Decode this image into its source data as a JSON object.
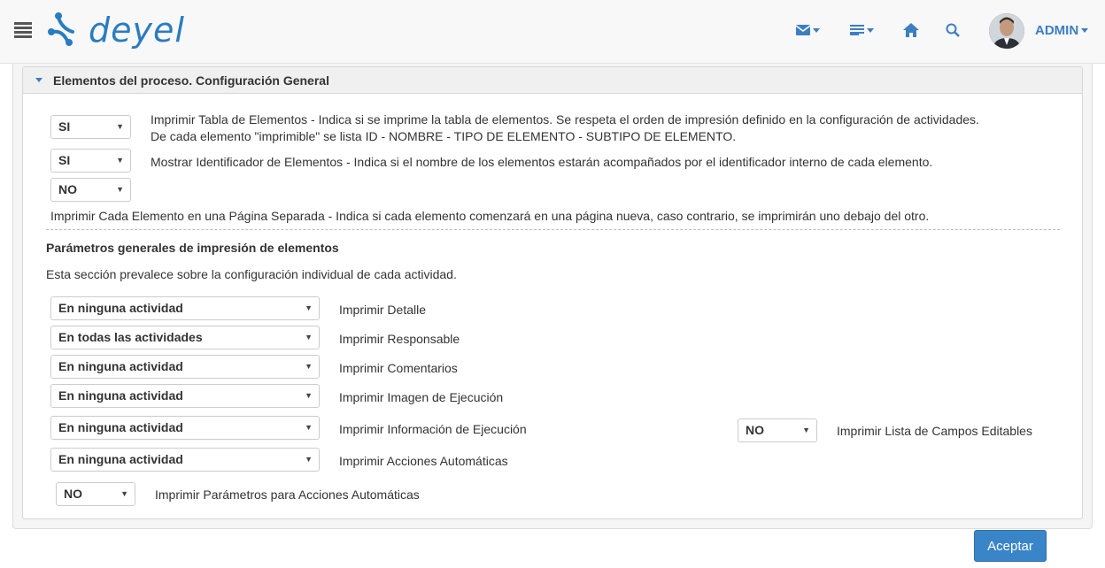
{
  "header": {
    "logo_text": "deyel",
    "user_label": "ADMIN"
  },
  "panel": {
    "title": "Elementos del proceso. Configuración General"
  },
  "top_options": [
    {
      "value": "SI",
      "label_line1": "Imprimir Tabla de Elementos - Indica si se imprime la tabla de elementos. Se respeta el orden de impresión definido en la configuración de actividades.",
      "label_line2": "De cada elemento \"imprimible\" se lista ID - NOMBRE - TIPO DE ELEMENTO - SUBTIPO DE ELEMENTO."
    },
    {
      "value": "SI",
      "label": "Mostrar Identificador de Elementos - Indica si el nombre de los elementos estarán acompañados por el identificador interno de cada elemento."
    },
    {
      "value": "NO",
      "label": "Imprimir Cada Elemento en una Página Separada - Indica si cada elemento comenzará en una página nueva, caso contrario, se imprimirán uno debajo del otro."
    }
  ],
  "section": {
    "title": "Parámetros generales de impresión de elementos",
    "description": "Esta sección prevalece sobre la configuración individual de cada actividad."
  },
  "print_params": [
    {
      "value": "En ninguna actividad",
      "label": "Imprimir Detalle"
    },
    {
      "value": "En todas las actividades",
      "label": "Imprimir Responsable"
    },
    {
      "value": "En ninguna actividad",
      "label": "Imprimir Comentarios"
    },
    {
      "value": "En ninguna actividad",
      "label": "Imprimir Imagen de Ejecución"
    },
    {
      "value": "En ninguna actividad",
      "label": "Imprimir Información de Ejecución"
    },
    {
      "value": "En ninguna actividad",
      "label": "Imprimir Acciones Automáticas"
    }
  ],
  "editable_fields": {
    "value": "NO",
    "label": "Imprimir Lista de Campos Editables"
  },
  "auto_action_params": {
    "value": "NO",
    "label": "Imprimir Parámetros para Acciones Automáticas"
  },
  "accept_button": "Aceptar",
  "colors": {
    "accent": "#3c7ec2",
    "button": "#3a85c8"
  }
}
